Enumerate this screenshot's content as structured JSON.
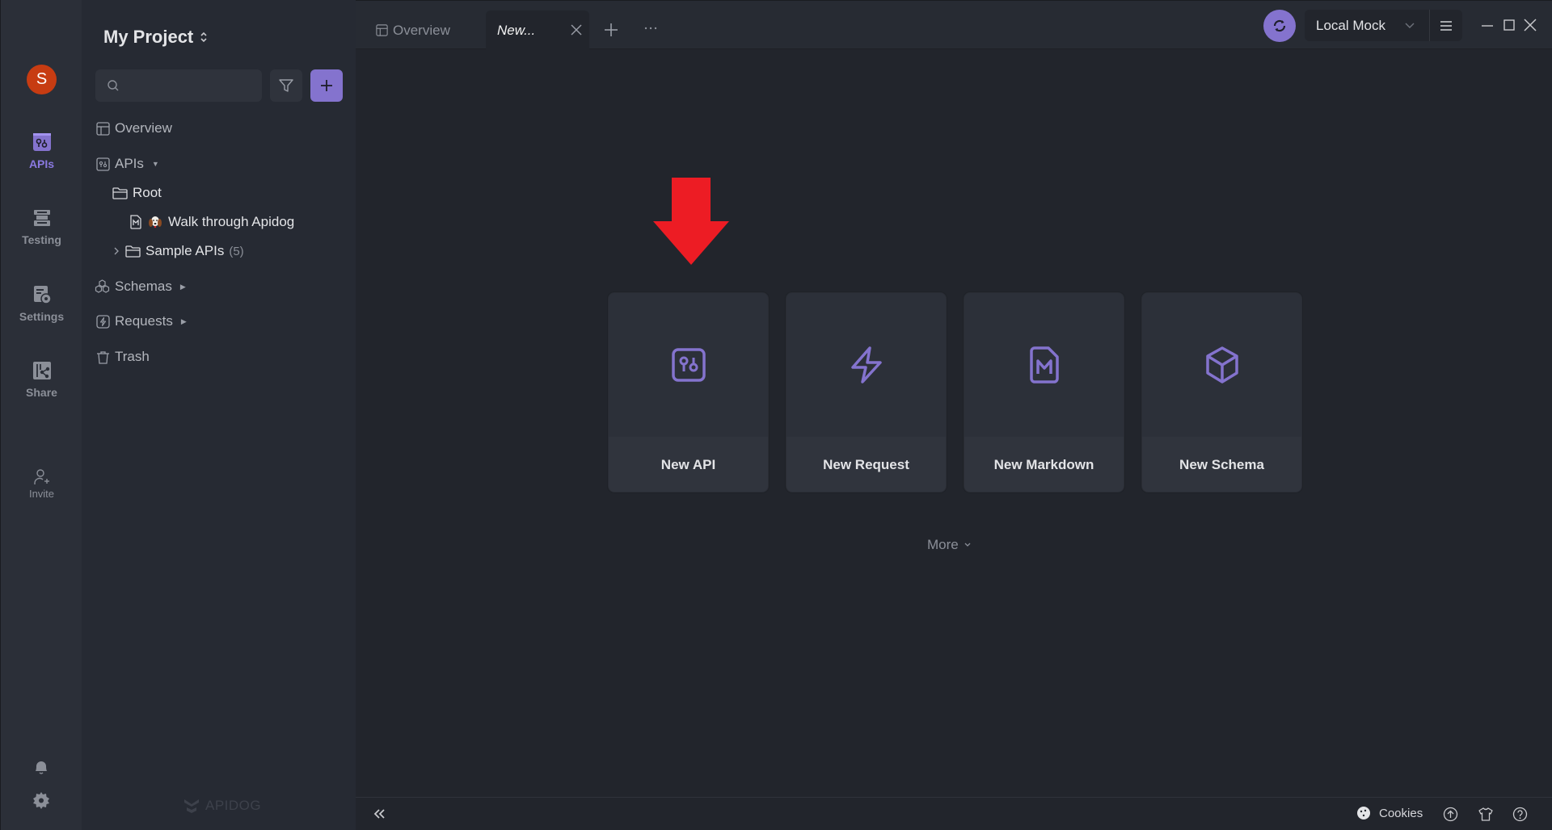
{
  "rail": {
    "avatar_initial": "S",
    "items": [
      {
        "label": "APIs",
        "icon": "api-icon",
        "active": true
      },
      {
        "label": "Testing",
        "icon": "testing-icon",
        "active": false
      },
      {
        "label": "Settings",
        "icon": "settings-icon",
        "active": false
      },
      {
        "label": "Share",
        "icon": "share-icon",
        "active": false
      }
    ],
    "invite_label": "Invite",
    "bottom_icons": [
      "bell-icon",
      "gear-icon"
    ]
  },
  "sidebar": {
    "project_title": "My Project",
    "search": {
      "placeholder": "",
      "value": ""
    },
    "tree": {
      "overview": "Overview",
      "apis": "APIs",
      "root": "Root",
      "walkthrough": "Walk through Apidog",
      "sample_apis": "Sample APIs",
      "sample_apis_count": "(5)",
      "schemas": "Schemas",
      "requests": "Requests",
      "trash": "Trash"
    },
    "brand": "APIDOG"
  },
  "tabs": [
    {
      "label": "Overview",
      "active": false
    },
    {
      "label": "New...",
      "active": true
    }
  ],
  "environment": {
    "selected": "Local Mock"
  },
  "main": {
    "cards": [
      {
        "label": "New API",
        "icon": "api-icon"
      },
      {
        "label": "New Request",
        "icon": "lightning-icon"
      },
      {
        "label": "New Markdown",
        "icon": "markdown-icon"
      },
      {
        "label": "New Schema",
        "icon": "cube-icon"
      }
    ],
    "more_label": "More"
  },
  "statusbar": {
    "cookies_label": "Cookies"
  },
  "colors": {
    "accent": "#8473ce",
    "avatar": "#c73c12",
    "annotation_arrow": "#ed1c24"
  }
}
